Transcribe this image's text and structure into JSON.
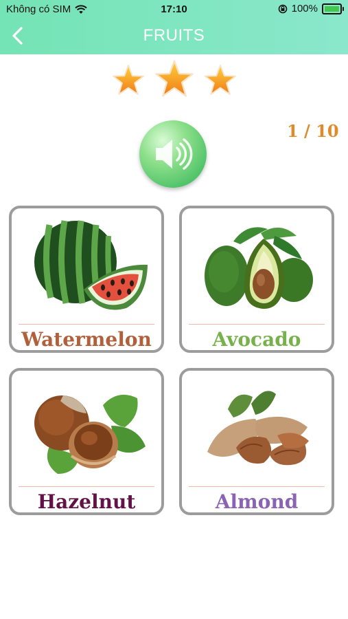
{
  "status_bar": {
    "carrier": "Không có SIM",
    "time": "17:10",
    "battery": "100%"
  },
  "header": {
    "title": "FRUITS"
  },
  "progress": {
    "stars_earned": 3,
    "counter": "1 / 10"
  },
  "cards": [
    {
      "label": "Watermelon",
      "label_color": "#b0613c",
      "image": "watermelon-image"
    },
    {
      "label": "Avocado",
      "label_color": "#77b14c",
      "image": "avocado-image"
    },
    {
      "label": "Hazelnut",
      "label_color": "#621246",
      "image": "hazelnut-image"
    },
    {
      "label": "Almond",
      "label_color": "#8a63b3",
      "image": "almond-image"
    }
  ],
  "colors": {
    "header_gradient_start": "#74e3b5",
    "header_gradient_end": "#8ae7cb",
    "counter": "#e08a2c",
    "star": "#f6a623",
    "sound_button": "#5fca6c"
  },
  "icons": {
    "back": "chevron-left-icon",
    "sound": "speaker-icon",
    "wifi": "wifi-icon",
    "orientation_lock": "rotation-lock-icon",
    "battery": "battery-icon"
  }
}
